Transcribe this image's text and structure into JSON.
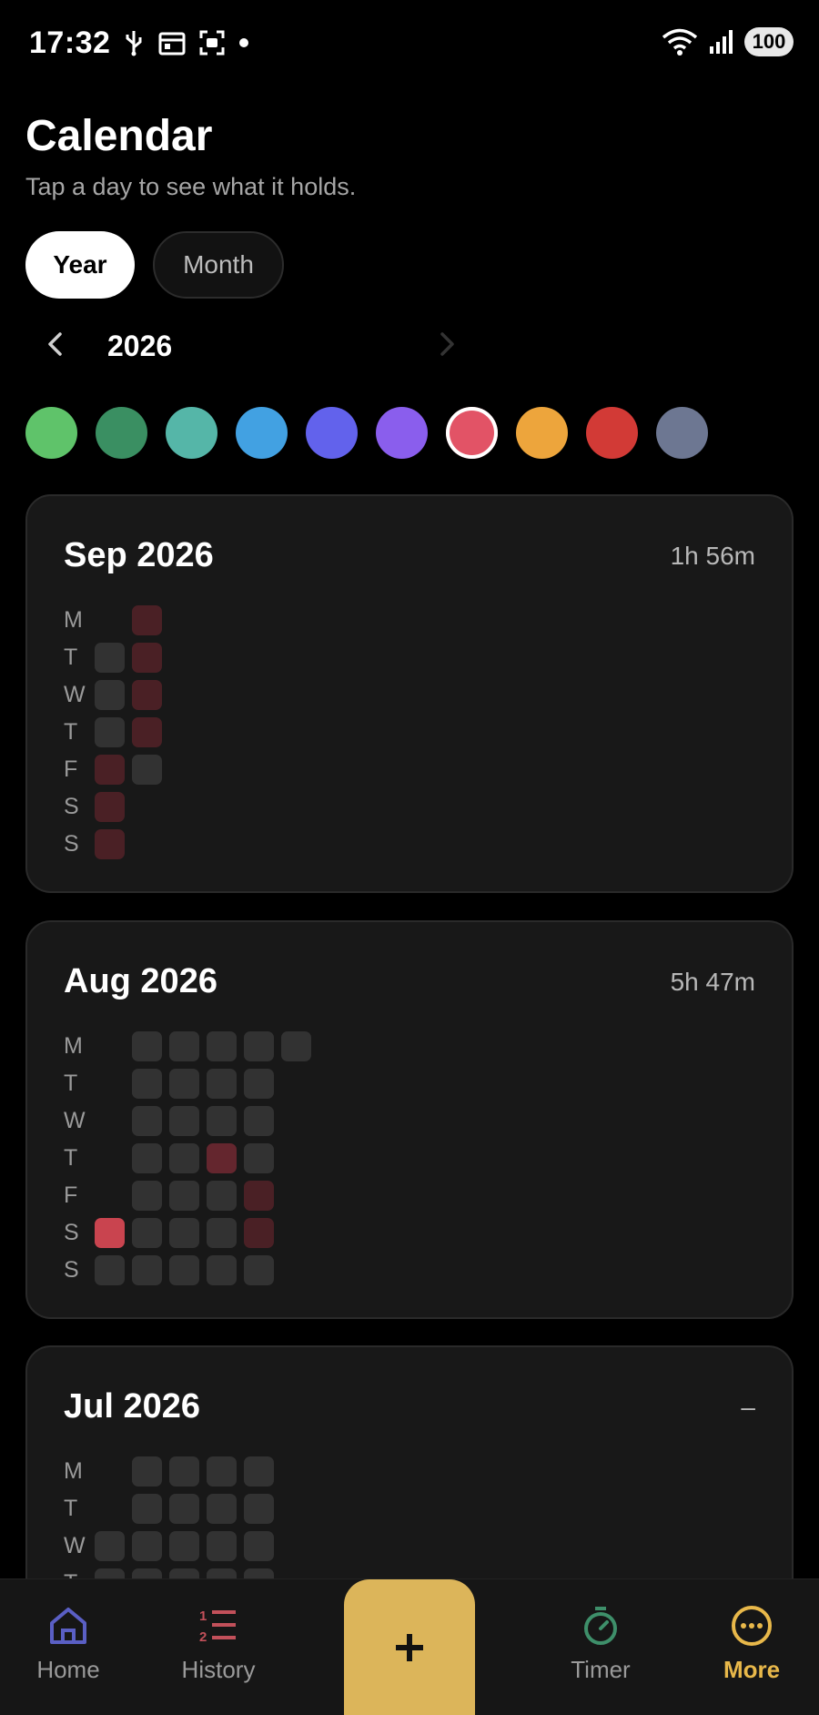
{
  "status_bar": {
    "time": "17:32",
    "left_icons": [
      "usb-icon",
      "calendar-notif-icon",
      "screenshot-icon",
      "dot-icon"
    ],
    "right_icons": [
      "wifi-icon",
      "signal-icon"
    ],
    "battery": "100"
  },
  "header": {
    "title": "Calendar",
    "subtitle": "Tap a day to see what it holds."
  },
  "view_toggle": {
    "year_label": "Year",
    "month_label": "Month",
    "selected": "Year"
  },
  "year_nav": {
    "year": "2026",
    "prev_icon": "chevron-left-icon",
    "next_icon": "chevron-right-icon"
  },
  "color_filters": {
    "colors": [
      "#5fc36a",
      "#3a8f62",
      "#55b6a8",
      "#42a1e2",
      "#6262ec",
      "#8a5eed",
      "#e25366",
      "#eda53c",
      "#d23a36",
      "#6d7792"
    ],
    "selected_index": 6
  },
  "day_labels": [
    "M",
    "T",
    "W",
    "T",
    "F",
    "S",
    "S"
  ],
  "cell_colors": {
    "empty": "#323232",
    "low": "#4a2025",
    "mid": "#64262e",
    "high": "#c9444f"
  },
  "months": [
    {
      "title": "Sep 2026",
      "total": "1h 56m",
      "cells": [
        {
          "week": 0,
          "weekday": 1,
          "level": "empty"
        },
        {
          "week": 0,
          "weekday": 2,
          "level": "empty"
        },
        {
          "week": 0,
          "weekday": 3,
          "level": "empty"
        },
        {
          "week": 0,
          "weekday": 4,
          "level": "low"
        },
        {
          "week": 0,
          "weekday": 5,
          "level": "low"
        },
        {
          "week": 0,
          "weekday": 6,
          "level": "low"
        },
        {
          "week": 1,
          "weekday": 0,
          "level": "low"
        },
        {
          "week": 1,
          "weekday": 1,
          "level": "low"
        },
        {
          "week": 1,
          "weekday": 2,
          "level": "low"
        },
        {
          "week": 1,
          "weekday": 3,
          "level": "low"
        },
        {
          "week": 1,
          "weekday": 4,
          "level": "empty"
        }
      ]
    },
    {
      "title": "Aug 2026",
      "total": "5h 47m",
      "cells": [
        {
          "week": 0,
          "weekday": 5,
          "level": "high"
        },
        {
          "week": 0,
          "weekday": 6,
          "level": "empty"
        },
        {
          "week": 1,
          "weekday": 0,
          "level": "empty"
        },
        {
          "week": 1,
          "weekday": 1,
          "level": "empty"
        },
        {
          "week": 1,
          "weekday": 2,
          "level": "empty"
        },
        {
          "week": 1,
          "weekday": 3,
          "level": "empty"
        },
        {
          "week": 1,
          "weekday": 4,
          "level": "empty"
        },
        {
          "week": 1,
          "weekday": 5,
          "level": "empty"
        },
        {
          "week": 1,
          "weekday": 6,
          "level": "empty"
        },
        {
          "week": 2,
          "weekday": 0,
          "level": "empty"
        },
        {
          "week": 2,
          "weekday": 1,
          "level": "empty"
        },
        {
          "week": 2,
          "weekday": 2,
          "level": "empty"
        },
        {
          "week": 2,
          "weekday": 3,
          "level": "empty"
        },
        {
          "week": 2,
          "weekday": 4,
          "level": "empty"
        },
        {
          "week": 2,
          "weekday": 5,
          "level": "empty"
        },
        {
          "week": 2,
          "weekday": 6,
          "level": "empty"
        },
        {
          "week": 3,
          "weekday": 0,
          "level": "empty"
        },
        {
          "week": 3,
          "weekday": 1,
          "level": "empty"
        },
        {
          "week": 3,
          "weekday": 2,
          "level": "empty"
        },
        {
          "week": 3,
          "weekday": 3,
          "level": "mid"
        },
        {
          "week": 3,
          "weekday": 4,
          "level": "empty"
        },
        {
          "week": 3,
          "weekday": 5,
          "level": "empty"
        },
        {
          "week": 3,
          "weekday": 6,
          "level": "empty"
        },
        {
          "week": 4,
          "weekday": 0,
          "level": "empty"
        },
        {
          "week": 4,
          "weekday": 1,
          "level": "empty"
        },
        {
          "week": 4,
          "weekday": 2,
          "level": "empty"
        },
        {
          "week": 4,
          "weekday": 3,
          "level": "empty"
        },
        {
          "week": 4,
          "weekday": 4,
          "level": "low"
        },
        {
          "week": 4,
          "weekday": 5,
          "level": "low"
        },
        {
          "week": 4,
          "weekday": 6,
          "level": "empty"
        },
        {
          "week": 5,
          "weekday": 0,
          "level": "empty"
        }
      ]
    },
    {
      "title": "Jul 2026",
      "total": "–",
      "cells": [
        {
          "week": 0,
          "weekday": 2,
          "level": "empty"
        },
        {
          "week": 0,
          "weekday": 3,
          "level": "empty"
        },
        {
          "week": 1,
          "weekday": 0,
          "level": "empty"
        },
        {
          "week": 1,
          "weekday": 1,
          "level": "empty"
        },
        {
          "week": 1,
          "weekday": 2,
          "level": "empty"
        },
        {
          "week": 1,
          "weekday": 3,
          "level": "empty"
        },
        {
          "week": 2,
          "weekday": 0,
          "level": "empty"
        },
        {
          "week": 2,
          "weekday": 1,
          "level": "empty"
        },
        {
          "week": 2,
          "weekday": 2,
          "level": "empty"
        },
        {
          "week": 2,
          "weekday": 3,
          "level": "empty"
        },
        {
          "week": 3,
          "weekday": 0,
          "level": "empty"
        },
        {
          "week": 3,
          "weekday": 1,
          "level": "empty"
        },
        {
          "week": 3,
          "weekday": 2,
          "level": "empty"
        },
        {
          "week": 3,
          "weekday": 3,
          "level": "empty"
        },
        {
          "week": 4,
          "weekday": 0,
          "level": "empty"
        },
        {
          "week": 4,
          "weekday": 1,
          "level": "empty"
        },
        {
          "week": 4,
          "weekday": 2,
          "level": "empty"
        },
        {
          "week": 4,
          "weekday": 3,
          "level": "empty"
        }
      ]
    }
  ],
  "bottom_nav": {
    "items": [
      {
        "label": "Home",
        "icon": "home-icon",
        "color": "#5a5fc4"
      },
      {
        "label": "History",
        "icon": "numbered-list-icon",
        "color": "#c2505a"
      },
      {
        "label": "Timer",
        "icon": "stopwatch-icon",
        "color": "#3e8f6a"
      },
      {
        "label": "More",
        "icon": "more-circle-icon",
        "color": "#e8b84a"
      }
    ],
    "fab_icon": "plus-icon",
    "fab_color": "#dcb55a",
    "active": "More"
  }
}
